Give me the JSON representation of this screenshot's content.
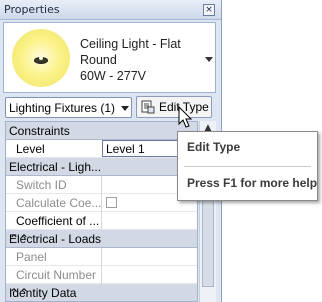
{
  "window": {
    "title": "Properties",
    "close_glyph": "×"
  },
  "type_selector": {
    "thumbnail_icon": "ceiling-light-icon",
    "name_line1": "Ceiling Light - Flat",
    "name_line2": "Round",
    "name_line3": "60W - 277V"
  },
  "filter": {
    "category_label": "Lighting Fixtures (1)",
    "edit_type_label": "Edit Type"
  },
  "grid": {
    "constraints_header": "Constraints",
    "level_label": "Level",
    "level_value": "Level 1",
    "electrical_lighting_header": "Electrical - Ligh...",
    "switch_id_label": "Switch ID",
    "calc_coeff_label": "Calculate Coe...",
    "coeff_of_label": "Coefficient of ...",
    "electrical_loads_header": "Electrical - Loads",
    "panel_label": "Panel",
    "circuit_number_label": "Circuit Number",
    "identity_data_header": "Identity Data",
    "collapse_glyph": "⌃⌃"
  },
  "tooltip": {
    "title": "Edit Type",
    "help": "Press F1 for more help"
  },
  "colors": {
    "palette_bg": "#dde5f1",
    "header_bg": "#d2d9e4",
    "thumb_yellow": "#fbf38a"
  }
}
